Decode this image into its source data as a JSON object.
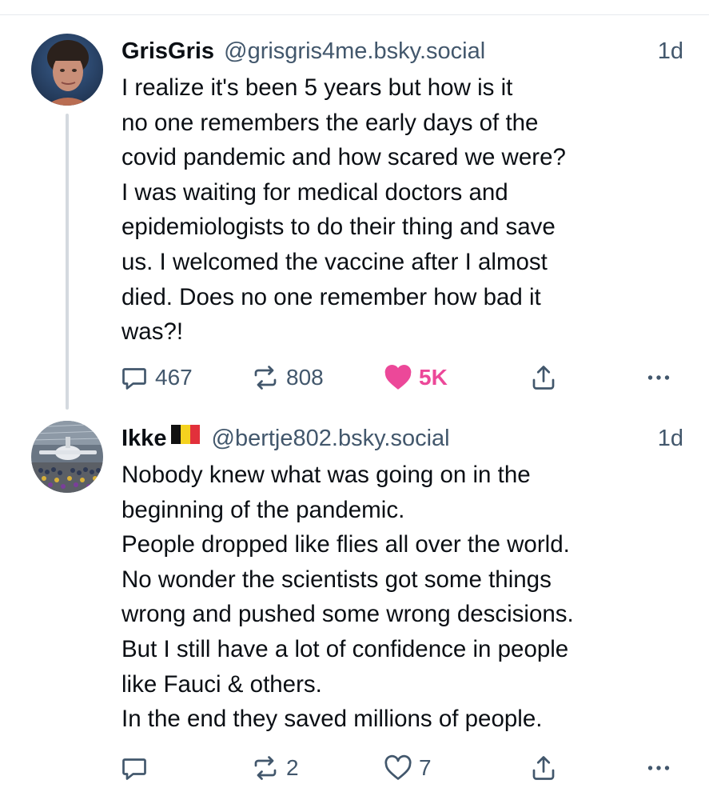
{
  "posts": [
    {
      "display_name": "GrisGris",
      "handle": "@grisgris4me.bsky.social",
      "timestamp": "1d",
      "avatar_icon": "avatar-photo-woman",
      "text_lines": [
        "I realize it's been 5 years but how is it",
        "no one remembers the early days of the",
        "covid pandemic and how scared we were?",
        "I was waiting for medical doctors and",
        "epidemiologists to do their thing and save",
        "us. I welcomed the vaccine after I almost",
        "died. Does no one remember how bad it",
        "was?!"
      ],
      "replies": "467",
      "reposts": "808",
      "likes": "5K",
      "liked": true
    },
    {
      "display_name": "Ikke",
      "flag": "belgium-flag",
      "handle": "@bertje802.bsky.social",
      "timestamp": "1d",
      "avatar_icon": "avatar-photo-airplane-crowd",
      "text_lines": [
        "Nobody knew what was going on in the",
        "beginning of the pandemic.",
        "People dropped like flies all over the world.",
        "No wonder the scientists got some things",
        "wrong and pushed some wrong descisions.",
        "But I still have a lot of confidence in people",
        "like Fauci & others.",
        "In the end they saved millions of people."
      ],
      "replies": "",
      "reposts": "2",
      "likes": "7",
      "liked": false
    }
  ],
  "colors": {
    "text": "#0b0f14",
    "muted": "#42576c",
    "like_active": "#ec4899",
    "thread_line": "#d4d9df"
  },
  "icons": {
    "reply": "reply-icon",
    "repost": "repost-icon",
    "like": "heart-icon",
    "share": "share-icon",
    "more": "more-options-icon"
  }
}
